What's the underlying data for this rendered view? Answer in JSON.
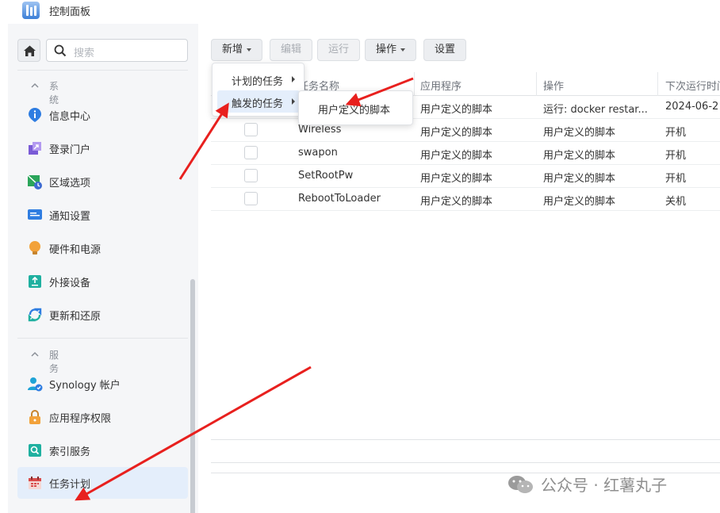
{
  "window": {
    "title": "控制面板"
  },
  "sidebar": {
    "search_placeholder": "搜索",
    "sections": [
      {
        "label": "系统",
        "items": [
          {
            "label": "信息中心",
            "icon": "info-icon",
            "color": "#2f7de1"
          },
          {
            "label": "登录门户",
            "icon": "login-portal-icon",
            "color": "#7a5bd6"
          },
          {
            "label": "区域选项",
            "icon": "region-icon",
            "color": "#2aa55a"
          },
          {
            "label": "通知设置",
            "icon": "notification-icon",
            "color": "#2f7de1"
          },
          {
            "label": "硬件和电源",
            "icon": "bulb-icon",
            "color": "#f2a23b"
          },
          {
            "label": "外接设备",
            "icon": "external-device-icon",
            "color": "#1fb0a0"
          },
          {
            "label": "更新和还原",
            "icon": "update-icon",
            "color": "#2f7de1"
          }
        ]
      },
      {
        "label": "服务",
        "items": [
          {
            "label": "Synology 帐户",
            "icon": "account-icon",
            "color": "#1fa3d6"
          },
          {
            "label": "应用程序权限",
            "icon": "lock-icon",
            "color": "#f2a23b"
          },
          {
            "label": "索引服务",
            "icon": "index-icon",
            "color": "#1fb0a0"
          },
          {
            "label": "任务计划",
            "icon": "calendar-icon",
            "color": "#d94b4b",
            "active": true
          }
        ]
      }
    ]
  },
  "toolbar": {
    "create": "新增",
    "edit": "编辑",
    "run": "运行",
    "action": "操作",
    "settings": "设置"
  },
  "table": {
    "columns": [
      "任务名称",
      "应用程序",
      "操作",
      "下次运行时间"
    ],
    "rows": [
      {
        "name": "",
        "app": "用户定义的脚本",
        "action": "运行: docker restar...",
        "next": "2024-06-2"
      },
      {
        "name": "Wireless",
        "app": "用户定义的脚本",
        "action": "用户定义的脚本",
        "next": "开机"
      },
      {
        "name": "swapon",
        "app": "用户定义的脚本",
        "action": "用户定义的脚本",
        "next": "开机"
      },
      {
        "name": "SetRootPw",
        "app": "用户定义的脚本",
        "action": "用户定义的脚本",
        "next": "开机"
      },
      {
        "name": "RebootToLoader",
        "app": "用户定义的脚本",
        "action": "用户定义的脚本",
        "next": "关机"
      }
    ]
  },
  "create_menu": {
    "items": [
      "计划的任务",
      "触发的任务"
    ],
    "submenu": [
      "用户定义的脚本"
    ]
  },
  "watermark": {
    "text": "公众号 · 红薯丸子"
  },
  "annotation_color": "#e8201e"
}
